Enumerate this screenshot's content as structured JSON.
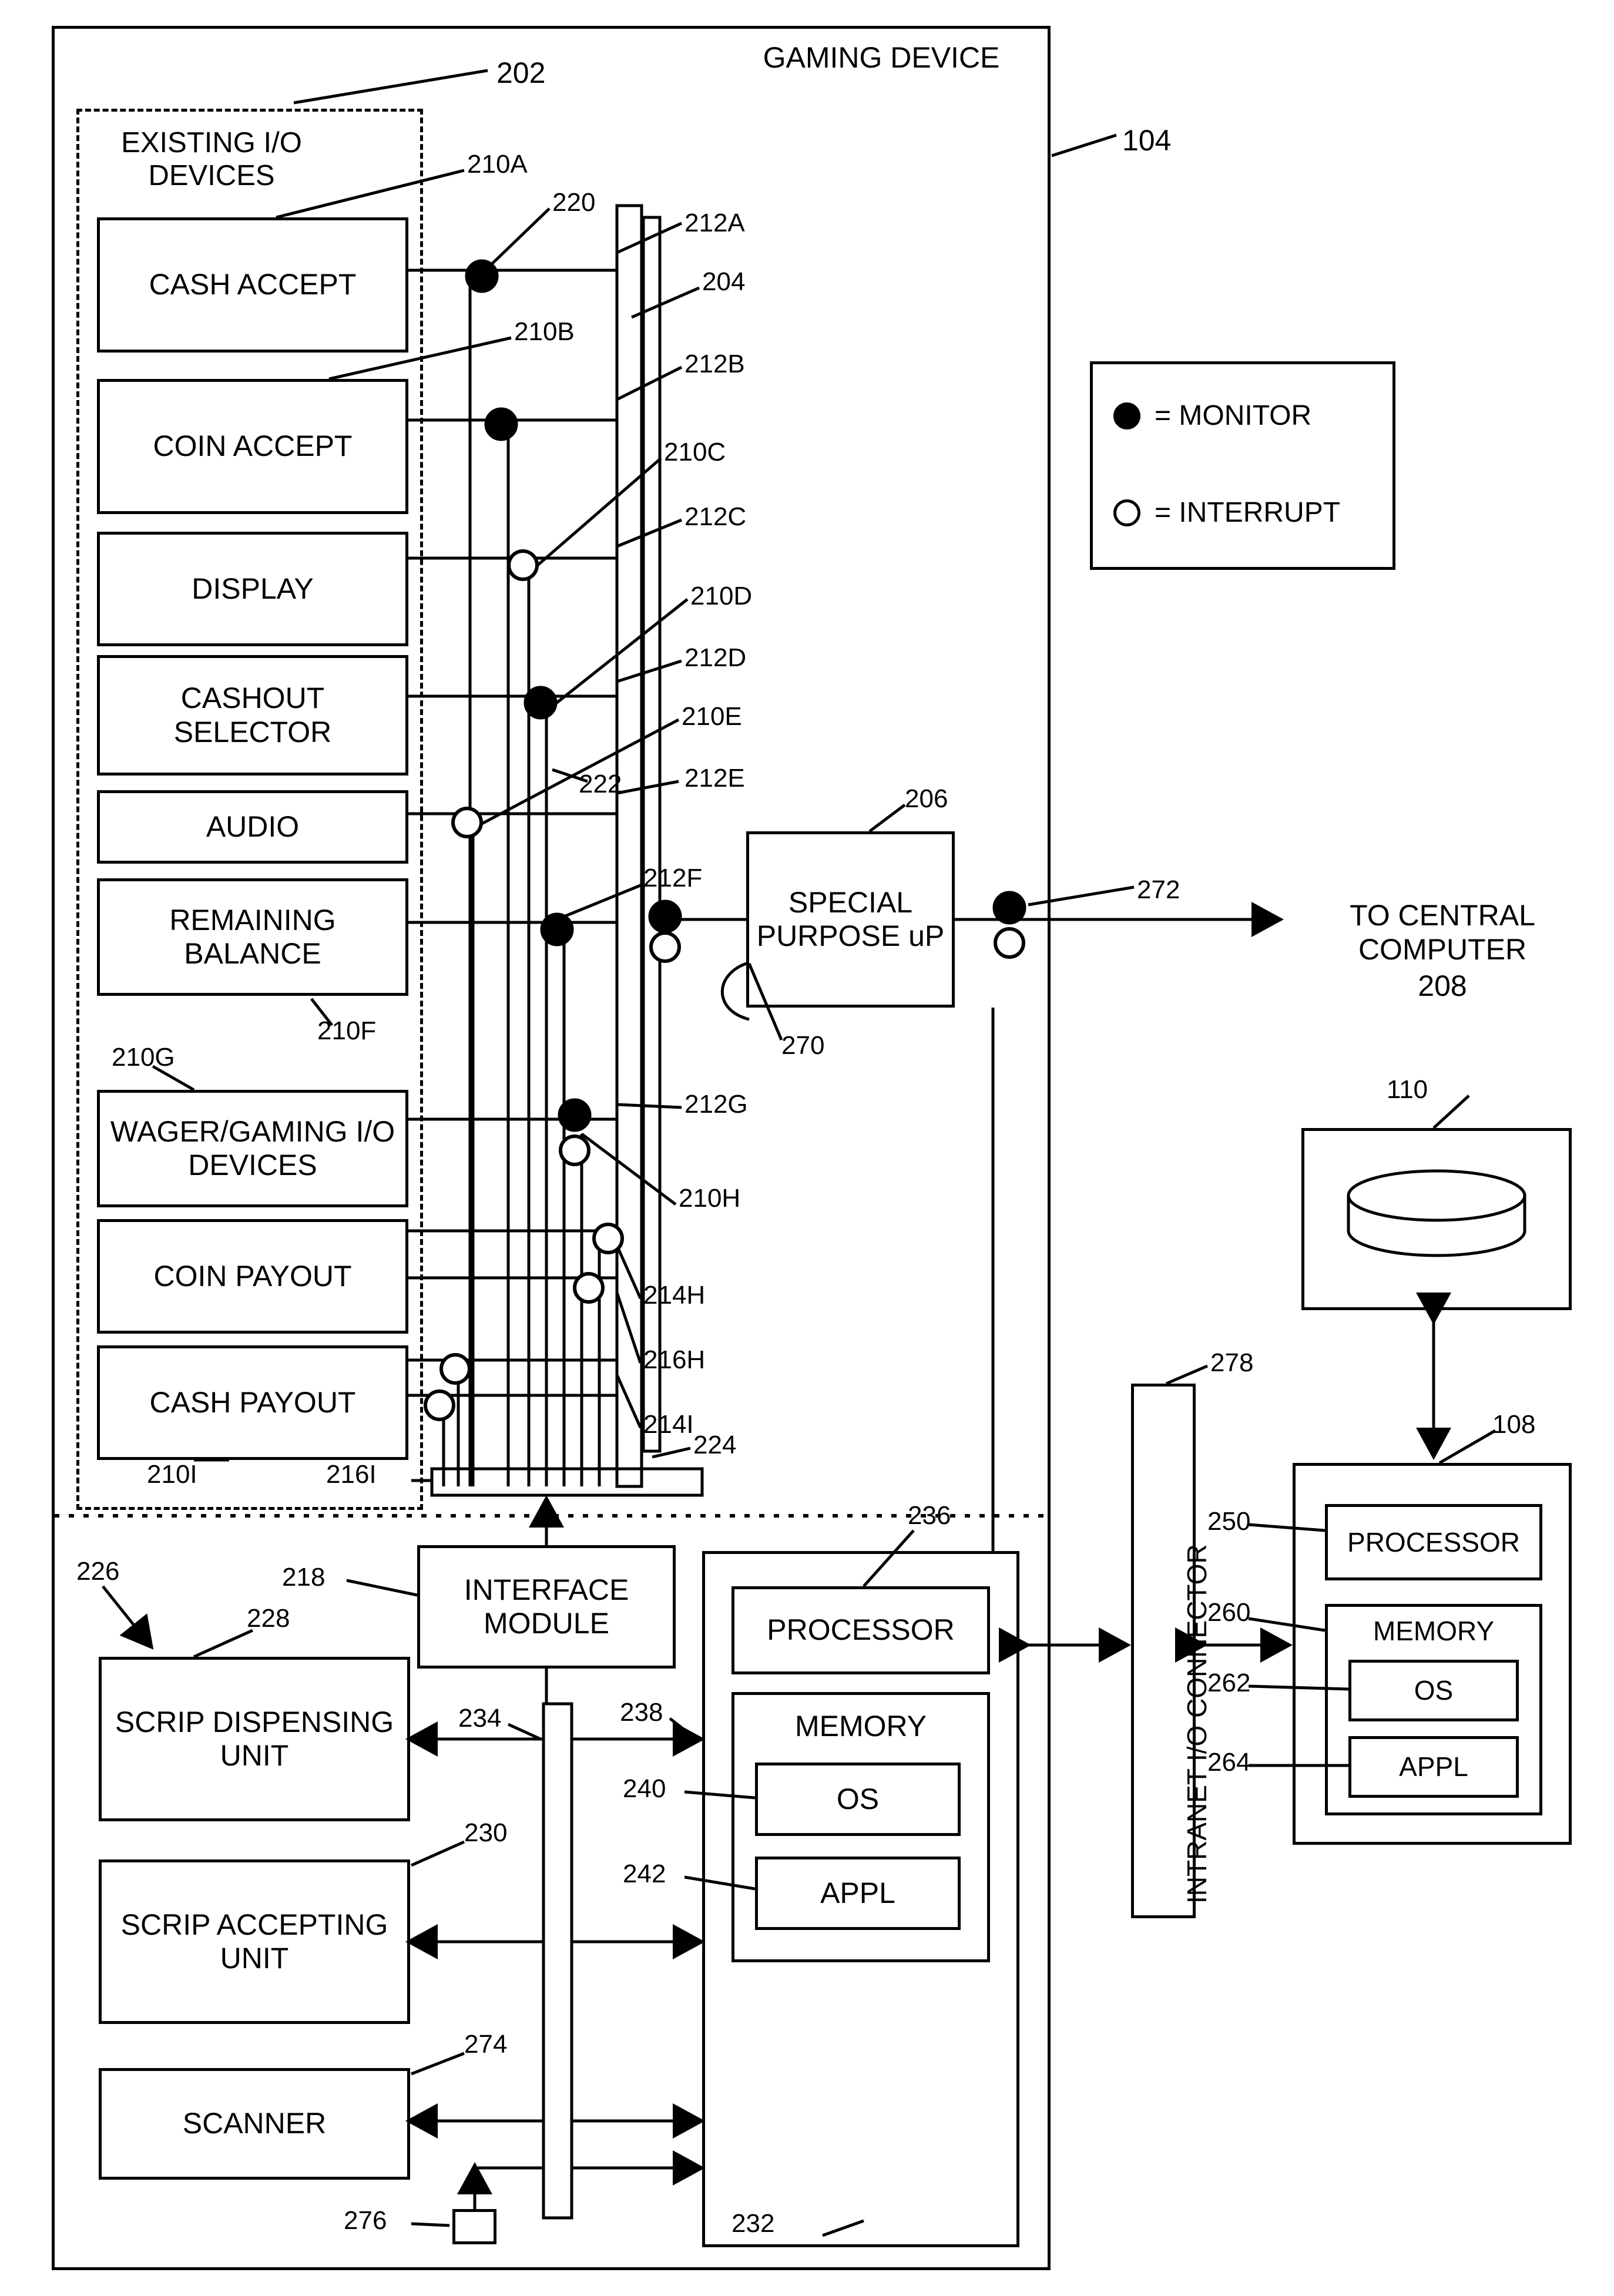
{
  "diagram": {
    "title": "GAMING DEVICE",
    "outer_ref": "104",
    "dashed_group_label": "EXISTING I/O\nDEVICES",
    "dashed_group_ref": "202",
    "io_devices": [
      {
        "label": "CASH\nACCEPT",
        "ref": "210A"
      },
      {
        "label": "COIN\nACCEPT",
        "ref": "210B"
      },
      {
        "label": "DISPLAY",
        "ref": "210C"
      },
      {
        "label": "CASHOUT\nSELECTOR",
        "ref": "210D"
      },
      {
        "label": "AUDIO",
        "ref": "210E"
      },
      {
        "label": "REMAINING\nBALANCE",
        "ref": "210F"
      },
      {
        "label": "WAGER/GAMING\nI/O DEVICES",
        "ref": "210G"
      },
      {
        "label": "COIN\nPAYOUT",
        "ref": "210H"
      },
      {
        "label": "CASH\nPAYOUT",
        "ref": "210I"
      }
    ],
    "bus_refs": [
      "220",
      "204",
      "222",
      "224"
    ],
    "tap_refs": [
      "212A",
      "212B",
      "212C",
      "212D",
      "212E",
      "212F",
      "212G",
      "214H",
      "216H",
      "214I",
      "216I"
    ],
    "legend": {
      "monitor": "= MONITOR",
      "interrupt": "= INTERRUPT"
    },
    "special_purpose": {
      "label": "SPECIAL\nPURPOSE\nuP",
      "ref": "206",
      "ref2": "270"
    },
    "central": {
      "label": "TO CENTRAL\nCOMPUTER",
      "ref": "208",
      "link_ref": "272"
    },
    "interface_module": {
      "label": "INTERFACE\nMODULE",
      "ref": "218"
    },
    "scrip_group_ref": "226",
    "scrip_units": [
      {
        "label": "SCRIP\nDISPENSING\nUNIT",
        "ref": "228"
      },
      {
        "label": "SCRIP\nACCEPTING\nUNIT",
        "ref": "230"
      },
      {
        "label": "SCANNER",
        "ref": "274"
      }
    ],
    "small_block_ref": "276",
    "bus234_ref": "234",
    "bus238_ref": "238",
    "controller": {
      "ref": "232",
      "processor": {
        "label": "PROCESSOR",
        "ref": "236"
      },
      "memory": {
        "label": "MEMORY",
        "os": "OS",
        "appl": "APPL",
        "os_ref": "240",
        "appl_ref": "242"
      }
    },
    "intranet_connector": {
      "label": "INTRANET I/O CONNECTOR",
      "ref": "278"
    },
    "server": {
      "ref": "108",
      "processor": {
        "label": "PROCESSOR",
        "ref": "250"
      },
      "memory": {
        "label": "MEMORY",
        "ref": "260",
        "os": "OS",
        "appl": "APPL",
        "os_ref": "262",
        "appl_ref": "264"
      }
    },
    "database": {
      "ref": "110"
    }
  }
}
